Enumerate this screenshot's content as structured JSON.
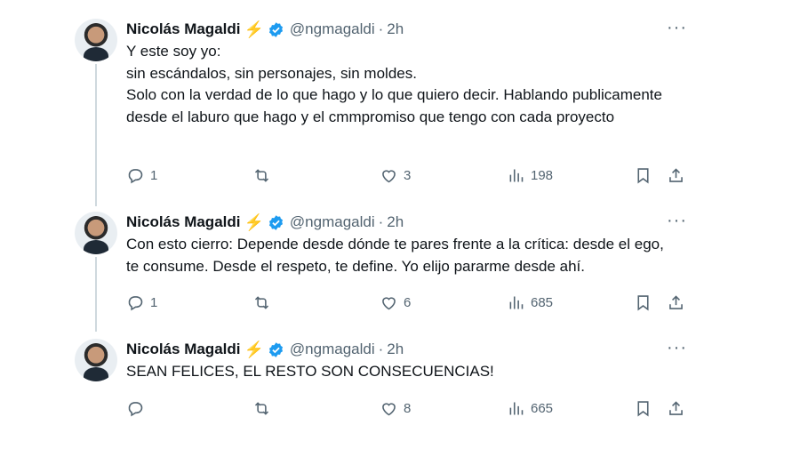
{
  "tweets": [
    {
      "author": "Nicolás Magaldi",
      "badge": "⚡",
      "handle": "@ngmagaldi",
      "separator": "·",
      "time": "2h",
      "more": "···",
      "text": "Y este soy yo:\nsin escándalos, sin personajes, sin moldes.\nSolo con la verdad de lo que hago y lo que quiero decir. Hablando publicamente desde el laburo que hago y el cmmpromiso que tengo con cada proyecto",
      "replies": "1",
      "reposts": "",
      "likes": "3",
      "views": "198"
    },
    {
      "author": "Nicolás Magaldi",
      "badge": "⚡",
      "handle": "@ngmagaldi",
      "separator": "·",
      "time": "2h",
      "more": "···",
      "text": "Con esto cierro: Depende desde dónde te pares frente a la crítica: desde el ego, te consume. Desde el respeto, te define. Yo elijo pararme desde ahí.",
      "replies": "1",
      "reposts": "",
      "likes": "6",
      "views": "685"
    },
    {
      "author": "Nicolás Magaldi",
      "badge": "⚡",
      "handle": "@ngmagaldi",
      "separator": "·",
      "time": "2h",
      "more": "···",
      "text": "SEAN FELICES, EL RESTO SON CONSECUENCIAS!",
      "replies": "",
      "reposts": "",
      "likes": "8",
      "views": "665"
    }
  ],
  "colors": {
    "text": "#0f1419",
    "muted": "#536471",
    "verified": "#1d9bf0",
    "bolt": "#f6b400",
    "thread_line": "#cfd9de"
  },
  "icons": [
    "reply-icon",
    "repost-icon",
    "like-icon",
    "views-icon",
    "bookmark-icon",
    "share-icon",
    "verified-icon",
    "more-icon"
  ]
}
